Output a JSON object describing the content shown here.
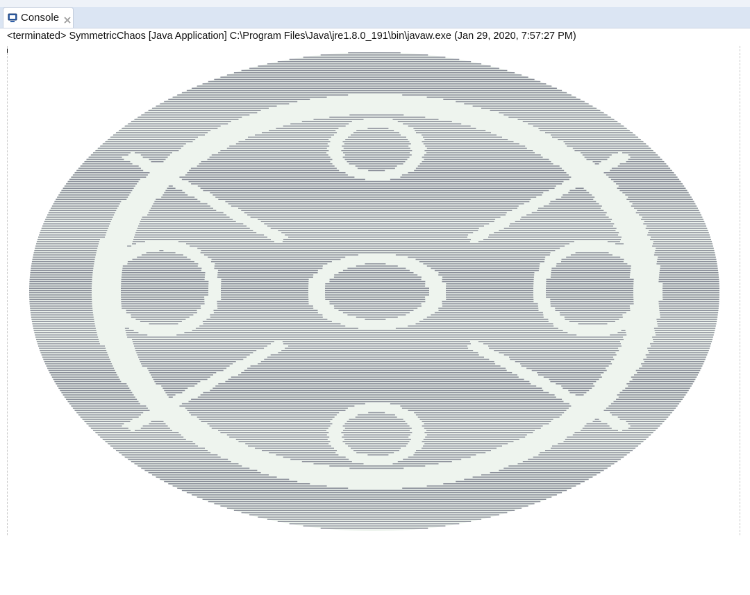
{
  "tab": {
    "label": "Console",
    "icon": "console-icon",
    "close_icon": "close-icon"
  },
  "status_line": "<terminated> SymmetricChaos [Java Application] C:\\Program Files\\Java\\jre1.8.0_191\\bin\\javaw.exe (Jan 29, 2020, 7:57:27 PM)",
  "colors": {
    "text_gray": "#8a8e99",
    "pattern_light": "#eef4ee",
    "tab_strip": "#dbe5f3"
  }
}
